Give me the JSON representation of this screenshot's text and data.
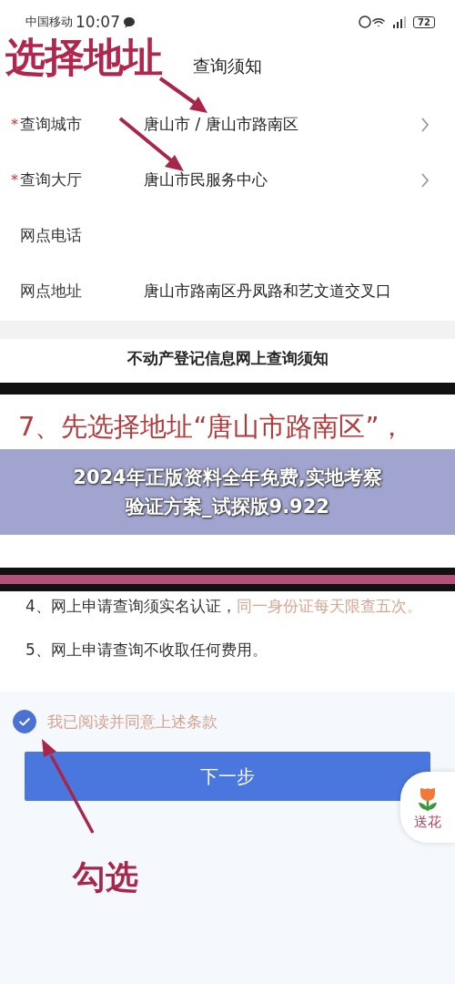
{
  "status_bar": {
    "carrier": "中国移动",
    "time": "10:07",
    "battery": "72"
  },
  "annotation_top": "选择地址",
  "page_title": "查询须知",
  "form_rows": [
    {
      "mark": "*",
      "label": "查询城市",
      "value": "唐山市 / 唐山市路南区",
      "kind": "select"
    },
    {
      "mark": "*",
      "label": "查询大厅",
      "value": "唐山市民服务中心",
      "kind": "select"
    },
    {
      "label": "网点电话",
      "kind": "text"
    },
    {
      "label": "网点地址",
      "value": "唐山市路南区丹凤路和艺文道交叉口",
      "kind": "text"
    }
  ],
  "notice_title": "不动产登记信息网上查询须知",
  "step_text": "7、先选择地址“唐山市路南区”，",
  "banner": {
    "lines": [
      "2024年正版资料全年免费,实地考察",
      "验证方案_试探版9.922"
    ]
  },
  "notice_items": [
    {
      "text": "4、网上申请查询须实名认证，",
      "highlight": "同一身份证每天限查五次。"
    },
    {
      "text": "5、网上申请查询不收取任何费用。"
    }
  ],
  "agreement": {
    "label": "我已阅读并同意上述条款",
    "checked": true
  },
  "next_button": "下一步",
  "float_button": "送花",
  "annotation_bottom": "勾选"
}
